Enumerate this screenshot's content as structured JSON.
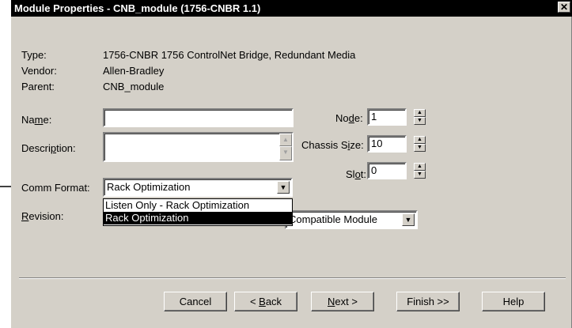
{
  "window": {
    "title": "Module Properties - CNB_module (1756-CNBR 1.1)",
    "close_glyph": "✕"
  },
  "info": {
    "type_label": "Type:",
    "type_value": "1756-CNBR 1756 ControlNet Bridge, Redundant Media",
    "vendor_label": "Vendor:",
    "vendor_value": "Allen-Bradley",
    "parent_label": "Parent:",
    "parent_value": "CNB_module"
  },
  "form": {
    "name_label_pre": "Na",
    "name_label_u": "m",
    "name_label_post": "e:",
    "name_value": "",
    "description_label_pre": "Descri",
    "description_label_u": "p",
    "description_label_post": "tion:",
    "description_value": "",
    "comm_format_label": "Comm Format:",
    "comm_format_value": "Rack Optimization",
    "revision_label_u": "R",
    "revision_label_post": "evision:",
    "electronic_keying_value": "Compatible Module",
    "node_label_pre": "No",
    "node_label_u": "d",
    "node_label_post": "e:",
    "node_value": "1",
    "chassis_label_pre": "Chassis S",
    "chassis_label_u": "i",
    "chassis_label_post": "ze:",
    "chassis_value": "10",
    "slot_label_pre": "Sl",
    "slot_label_u": "o",
    "slot_label_post": "t:",
    "slot_value": "0"
  },
  "comm_format_options": [
    "Listen Only - Rack Optimization",
    "Rack Optimization"
  ],
  "buttons": {
    "cancel": "Cancel",
    "back_pre": "< ",
    "back_u": "B",
    "back_post": "ack",
    "next_u": "N",
    "next_post": "ext >",
    "finish": "Finish >>",
    "help": "Help"
  },
  "colors": {
    "titlebar": "#000000",
    "dialog_bg": "#d4d0c8",
    "selection": "#000000"
  },
  "icons": {
    "pointer": "arrow-right-icon",
    "dropdown": "chevron-down-icon",
    "spinner": "spin-arrows-icon"
  }
}
